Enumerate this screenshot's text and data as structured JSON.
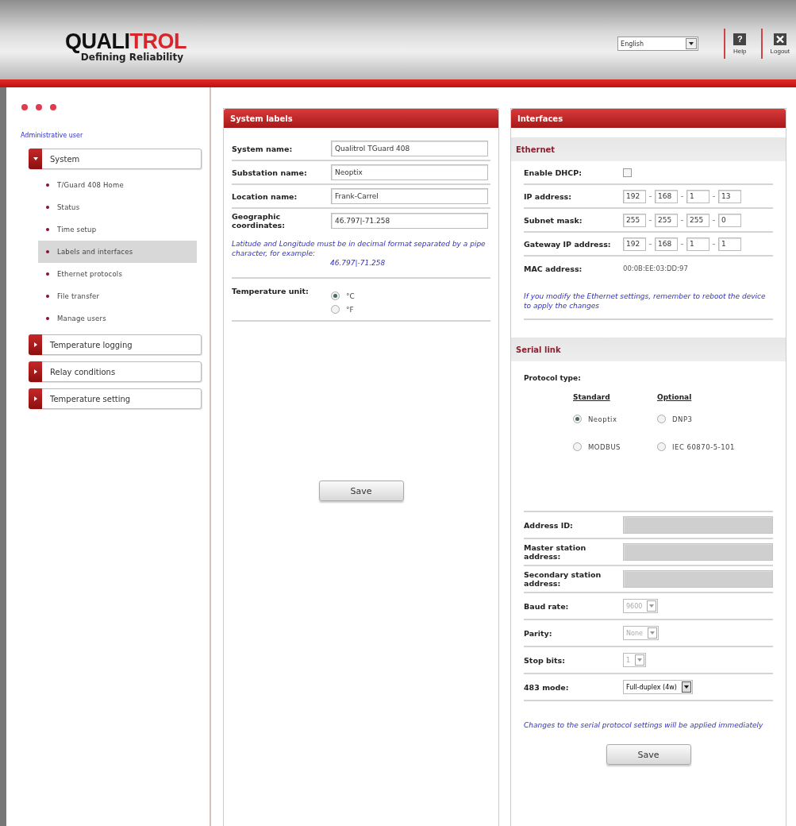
{
  "header": {
    "logo": [
      {
        "text": "QUALI",
        "color": "#111111"
      },
      {
        "text": "TROL",
        "color": "#d7262b"
      }
    ],
    "tagline": "Defining Reliability",
    "language": "English",
    "actions": [
      {
        "kind": "help",
        "glyph": "?",
        "label": "Help"
      },
      {
        "kind": "logout",
        "label": "Logout"
      }
    ]
  },
  "sidebar": {
    "user": "Administrative user",
    "sections": [
      {
        "label": "System",
        "expanded": true,
        "children": [
          {
            "label": "T/Guard 408 Home",
            "selected": false
          },
          {
            "label": "Status",
            "selected": false
          },
          {
            "label": "Time setup",
            "selected": false
          },
          {
            "label": "Labels and interfaces",
            "selected": true
          },
          {
            "label": "Ethernet protocols",
            "selected": false
          },
          {
            "label": "File transfer",
            "selected": false
          },
          {
            "label": "Manage users",
            "selected": false
          }
        ]
      },
      {
        "label": "Temperature logging",
        "expanded": false
      },
      {
        "label": "Relay conditions",
        "expanded": false
      },
      {
        "label": "Temperature setting",
        "expanded": false
      }
    ]
  },
  "system_labels": {
    "title": "System labels",
    "fields": [
      {
        "label": "System name:",
        "value": "Qualitrol TGuard 408"
      },
      {
        "label": "Substation name:",
        "value": "Neoptix"
      },
      {
        "label": "Location name:",
        "value": "Frank-Carrel"
      },
      {
        "label": "Geographic coordinates:",
        "value": "46.797|-71.258"
      }
    ],
    "note": "Latitude and Longitude must be in decimal format separated by a pipe character, for example:",
    "example": "46.797|-71.258",
    "unit_label": "Temperature unit:",
    "units": [
      {
        "label": "°C",
        "selected": true
      },
      {
        "label": "°F",
        "selected": false
      }
    ],
    "save": "Save"
  },
  "interfaces": {
    "title": "Interfaces",
    "ethernet": {
      "heading": "Ethernet",
      "dhcp": {
        "label": "Enable DHCP:",
        "checked": false
      },
      "addresses": [
        {
          "label": "IP address:",
          "octets": [
            "192",
            "168",
            "1",
            "13"
          ]
        },
        {
          "label": "Subnet mask:",
          "octets": [
            "255",
            "255",
            "255",
            "0"
          ]
        },
        {
          "label": "Gateway IP address:",
          "octets": [
            "192",
            "168",
            "1",
            "1"
          ]
        }
      ],
      "mac": {
        "label": "MAC address:",
        "value": "00:0B:EE:03:DD:97"
      },
      "note": "If you modify the Ethernet settings, remember to reboot the device to apply the changes"
    },
    "serial": {
      "heading": "Serial link",
      "protocol_label": "Protocol type:",
      "groups": [
        {
          "heading": "Standard",
          "options": [
            {
              "label": "Neoptix",
              "selected": true
            },
            {
              "label": "MODBUS",
              "selected": false
            }
          ]
        },
        {
          "heading": "Optional",
          "options": [
            {
              "label": "DNP3",
              "selected": false
            },
            {
              "label": "IEC 60870-5-101",
              "selected": false
            }
          ]
        }
      ],
      "fields": [
        {
          "kind": "text",
          "label": "Address ID:",
          "disabled": true
        },
        {
          "kind": "text",
          "label": "Master station address:",
          "disabled": true
        },
        {
          "kind": "text",
          "label": "Secondary station address:",
          "disabled": true
        },
        {
          "kind": "select",
          "label": "Baud rate:",
          "value": "9600",
          "disabled": true
        },
        {
          "kind": "select",
          "label": "Parity:",
          "value": "None",
          "disabled": true
        },
        {
          "kind": "select",
          "label": "Stop bits:",
          "value": "1",
          "disabled": true
        },
        {
          "kind": "select",
          "label": "483 mode:",
          "value": "Full-duplex (4w)",
          "disabled": false
        }
      ],
      "note": "Changes to the serial protocol settings will be applied immediately",
      "save": "Save"
    }
  }
}
